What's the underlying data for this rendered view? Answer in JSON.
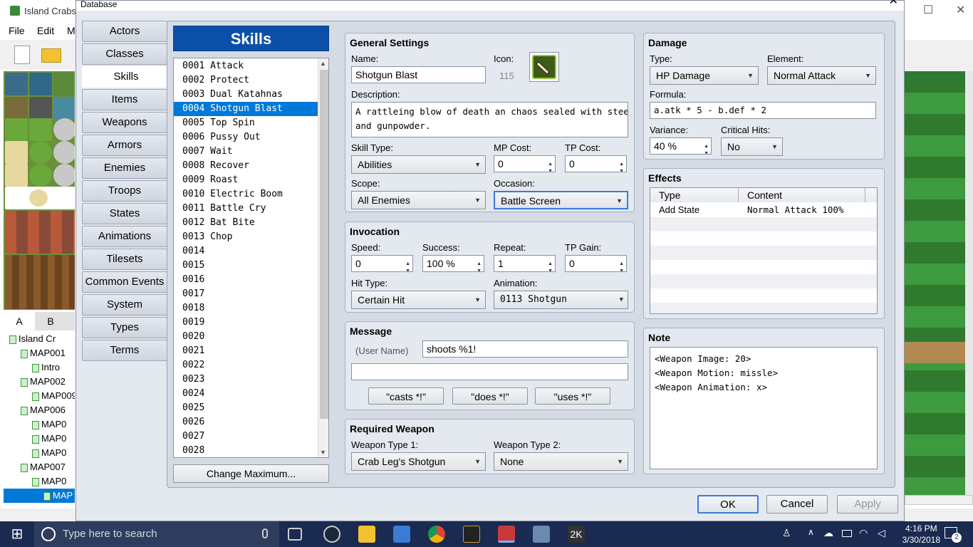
{
  "app_title": "Island Crabs",
  "bg_menu": [
    "File",
    "Edit",
    "M"
  ],
  "tileset_tabs": [
    "A",
    "B"
  ],
  "map_tree": [
    {
      "label": "Island Cr",
      "indent": 0
    },
    {
      "label": "MAP001",
      "indent": 1
    },
    {
      "label": "Intro",
      "indent": 2
    },
    {
      "label": "MAP002",
      "indent": 1
    },
    {
      "label": "MAP009",
      "indent": 2
    },
    {
      "label": "MAP006",
      "indent": 1
    },
    {
      "label": "MAP0",
      "indent": 2
    },
    {
      "label": "MAP0",
      "indent": 2
    },
    {
      "label": "MAP0",
      "indent": 2
    },
    {
      "label": "MAP007",
      "indent": 1
    },
    {
      "label": "MAP0",
      "indent": 2
    },
    {
      "label": "MAP",
      "indent": 3
    }
  ],
  "dialog": {
    "title": "Database"
  },
  "categories": [
    "Actors",
    "Classes",
    "Skills",
    "Items",
    "Weapons",
    "Armors",
    "Enemies",
    "Troops",
    "States",
    "Animations",
    "Tilesets",
    "Common Events",
    "System",
    "Types",
    "Terms"
  ],
  "active_category": "Skills",
  "skills_header": "Skills",
  "skills_list": [
    "0001 Attack",
    "0002 Protect",
    "0003 Dual Katahnas",
    "0004 Shotgun Blast",
    "0005 Top Spin",
    "0006 Pussy Out",
    "0007 Wait",
    "0008 Recover",
    "0009 Roast",
    "0010 Electric Boom",
    "0011 Battle Cry",
    "0012 Bat Bite",
    "0013 Chop",
    "0014",
    "0015",
    "0016",
    "0017",
    "0018",
    "0019",
    "0020",
    "0021",
    "0022",
    "0023",
    "0024",
    "0025",
    "0026",
    "0027",
    "0028"
  ],
  "selected_skill": "0004 Shotgun Blast",
  "change_max_label": "Change Maximum...",
  "general": {
    "title": "General Settings",
    "name_label": "Name:",
    "name_value": "Shotgun Blast",
    "icon_label": "Icon:",
    "icon_index": "115",
    "icon_name": "shotgun-icon",
    "desc_label": "Description:",
    "desc_value": "A rattleing blow of death an chaos sealed with steel\nand gunpowder.",
    "skill_type_label": "Skill Type:",
    "skill_type_value": "Abilities",
    "mp_label": "MP Cost:",
    "mp_value": "0",
    "tp_label": "TP Cost:",
    "tp_value": "0",
    "scope_label": "Scope:",
    "scope_value": "All Enemies",
    "occasion_label": "Occasion:",
    "occasion_value": "Battle Screen"
  },
  "invocation": {
    "title": "Invocation",
    "speed_label": "Speed:",
    "speed_value": "0",
    "success_label": "Success:",
    "success_value": "100 %",
    "repeat_label": "Repeat:",
    "repeat_value": "1",
    "tpgain_label": "TP Gain:",
    "tpgain_value": "0",
    "hittype_label": "Hit Type:",
    "hittype_value": "Certain Hit",
    "anim_label": "Animation:",
    "anim_value": "0113 Shotgun"
  },
  "message": {
    "title": "Message",
    "user_label": "(User Name)",
    "line1": "shoots %1!",
    "line2": "",
    "btn_casts": "\"casts *!\"",
    "btn_does": "\"does *!\"",
    "btn_uses": "\"uses *!\""
  },
  "required_weapon": {
    "title": "Required Weapon",
    "wt1_label": "Weapon Type 1:",
    "wt1_value": "Crab Leg's Shotgun",
    "wt2_label": "Weapon Type 2:",
    "wt2_value": "None"
  },
  "damage": {
    "title": "Damage",
    "type_label": "Type:",
    "type_value": "HP Damage",
    "element_label": "Element:",
    "element_value": "Normal Attack",
    "formula_label": "Formula:",
    "formula_value": "a.atk * 5 - b.def * 2",
    "variance_label": "Variance:",
    "variance_value": "40 %",
    "crit_label": "Critical Hits:",
    "crit_value": "No"
  },
  "effects": {
    "title": "Effects",
    "col_type": "Type",
    "col_content": "Content",
    "rows": [
      {
        "type": "Add State",
        "content": "Normal Attack 100%"
      }
    ]
  },
  "note": {
    "title": "Note",
    "text": "<Weapon Image: 20>\n<Weapon Motion: missle>\n<Weapon Animation: x>"
  },
  "buttons": {
    "ok": "OK",
    "cancel": "Cancel",
    "apply": "Apply"
  },
  "taskbar": {
    "search_placeholder": "Type here to search",
    "time": "4:16 PM",
    "date": "3/30/2018",
    "notif_count": "2"
  }
}
